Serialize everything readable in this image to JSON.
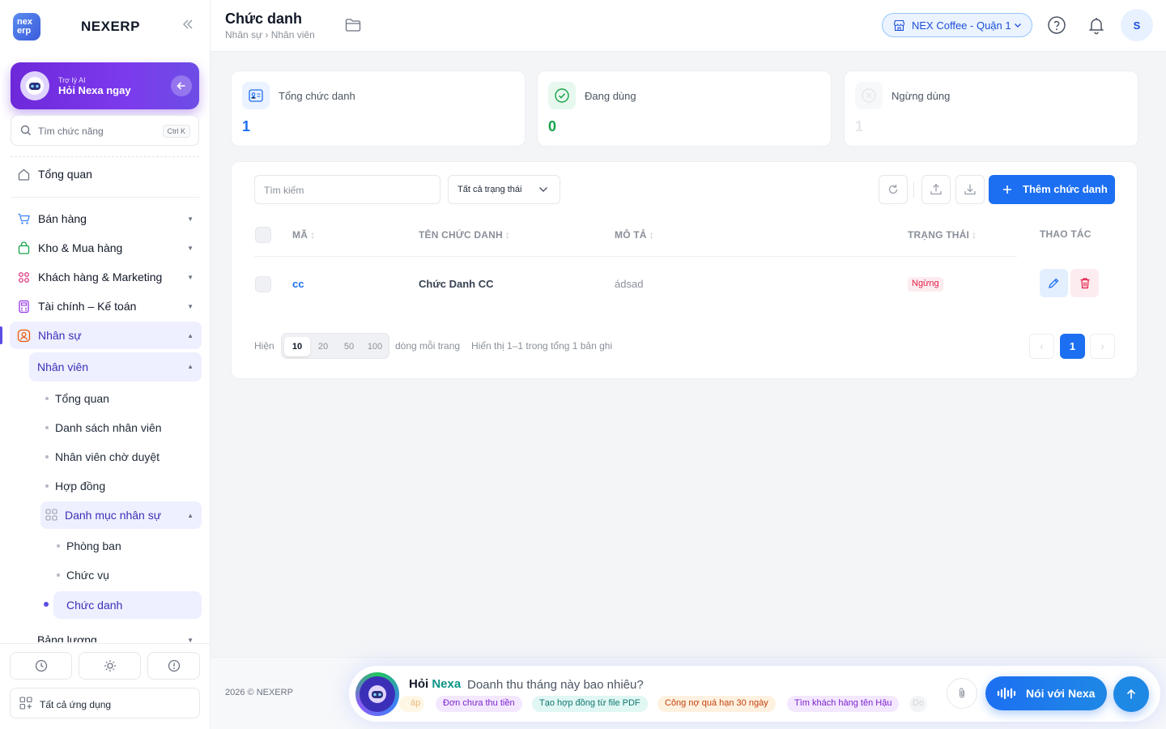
{
  "app": {
    "brand": "NEXERP",
    "logo_text": "nex erp"
  },
  "ai_card": {
    "small": "Trợ lý AI",
    "big": "Hỏi Nexa ngay"
  },
  "sidebar_search": {
    "placeholder": "Tìm chức năng",
    "shortcut": "Ctrl K"
  },
  "nav": {
    "overview": "Tổng quan",
    "sales": "Bán hàng",
    "inventory": "Kho & Mua hàng",
    "crm": "Khách hàng & Marketing",
    "finance": "Tài chính – Kế toán",
    "hr": "Nhân sự",
    "employees": "Nhân viên",
    "emp_overview": "Tổng quan",
    "emp_list": "Danh sách nhân viên",
    "emp_pending": "Nhân viên chờ duyệt",
    "contracts": "Hợp đồng",
    "hr_catalog": "Danh mục nhân sự",
    "departments": "Phòng ban",
    "positions": "Chức vụ",
    "job_titles": "Chức danh",
    "payroll": "Bảng lương",
    "all_apps": "Tất cả ứng dụng"
  },
  "header": {
    "title": "Chức danh",
    "breadcrumb": "Nhân sự › Nhân viên",
    "store": "NEX Coffee - Quận 1",
    "user_initial": "S"
  },
  "stats": [
    {
      "label": "Tổng chức danh",
      "value": "1",
      "color": "#1d6ff2"
    },
    {
      "label": "Đang dùng",
      "value": "0",
      "color": "#16a34a"
    },
    {
      "label": "Ngừng dùng",
      "value": "1",
      "color": "#e5e7eb"
    }
  ],
  "table": {
    "search_placeholder": "Tìm kiếm",
    "status_filter": "Tất cả trạng thái",
    "add_button": "Thêm chức danh",
    "headers": {
      "code": "MÃ",
      "name": "TÊN CHỨC DANH",
      "desc": "MÔ TẢ",
      "status": "TRẠNG THÁI",
      "actions": "THAO TÁC"
    },
    "rows": [
      {
        "code": "cc",
        "name": "Chức Danh CC",
        "desc": "ádsad",
        "status": "Ngừng"
      }
    ]
  },
  "pagination": {
    "show_label": "Hiện",
    "sizes": [
      "10",
      "20",
      "50",
      "100"
    ],
    "per_page_label": "dòng mỗi trang",
    "summary": "Hiển thị 1–1 trong tổng 1 bản ghi",
    "current": "1",
    "prev": "‹",
    "next": "›"
  },
  "footer": {
    "copyright": "2026 © NEXERP",
    "ask_prefix": "Hỏi",
    "ask_brand": "Nexa",
    "question": "Doanh thu tháng này bao nhiêu?",
    "chips": [
      "áp",
      "Đơn chưa thu tiền",
      "Tạo hợp đồng từ file PDF",
      "Công nợ quá hạn 30 ngày",
      "Tìm khách hàng tên Hậu",
      "Do"
    ],
    "voice_button": "Nói với Nexa"
  },
  "colors": {
    "accent": "#1d6ff2",
    "purple": "#6d28d9",
    "danger": "#e11d48",
    "success": "#16a34a"
  }
}
